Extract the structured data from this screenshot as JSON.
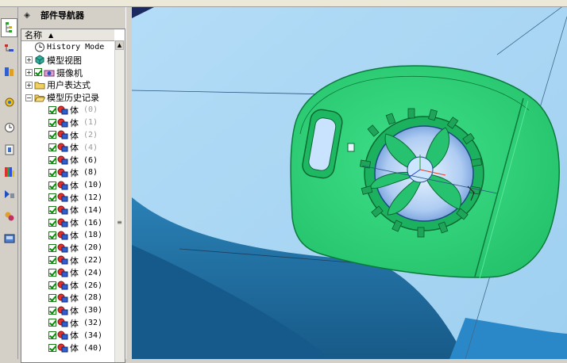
{
  "navigator": {
    "title": "部件导航器",
    "column_header": "名称",
    "history_mode": "History Mode",
    "nodes": [
      {
        "label": "模型视图",
        "icon": "model-views-icon"
      },
      {
        "label": "摄像机",
        "icon": "camera-icon"
      },
      {
        "label": "用户表达式",
        "icon": "folder-icon"
      },
      {
        "label": "模型历史记录",
        "icon": "folder-icon"
      }
    ],
    "features": [
      {
        "name": "体",
        "id": "(0)",
        "dim": true
      },
      {
        "name": "体",
        "id": "(1)",
        "dim": true
      },
      {
        "name": "体",
        "id": "(2)",
        "dim": true
      },
      {
        "name": "体",
        "id": "(4)",
        "dim": true
      },
      {
        "name": "体",
        "id": "(6)",
        "dim": false
      },
      {
        "name": "体",
        "id": "(8)",
        "dim": false
      },
      {
        "name": "体",
        "id": "(10)",
        "dim": false
      },
      {
        "name": "体",
        "id": "(12)",
        "dim": false
      },
      {
        "name": "体",
        "id": "(14)",
        "dim": false
      },
      {
        "name": "体",
        "id": "(16)",
        "dim": false
      },
      {
        "name": "体",
        "id": "(18)",
        "dim": false
      },
      {
        "name": "体",
        "id": "(20)",
        "dim": false
      },
      {
        "name": "体",
        "id": "(22)",
        "dim": false
      },
      {
        "name": "体",
        "id": "(24)",
        "dim": false
      },
      {
        "name": "体",
        "id": "(26)",
        "dim": false
      },
      {
        "name": "体",
        "id": "(28)",
        "dim": false
      },
      {
        "name": "体",
        "id": "(30)",
        "dim": false
      },
      {
        "name": "体",
        "id": "(32)",
        "dim": false
      },
      {
        "name": "体",
        "id": "(34)",
        "dim": false
      },
      {
        "name": "体",
        "id": "(40)",
        "dim": false
      }
    ]
  },
  "resource_bar": {
    "buttons": [
      "assembly-navigator-icon",
      "part-navigator-icon",
      "constraint-navigator-icon",
      "reuse-library-icon",
      "history-icon",
      "system-materials-icon",
      "visualization-icon",
      "roles-icon",
      "web-browser-icon",
      "palette-icon"
    ]
  },
  "colors": {
    "part_green": "#2fd47a",
    "part_green_dark": "#0b7a3a",
    "background_light_blue": "#b9def5",
    "background_dark_blue": "#1f6ea0",
    "check_green": "#0a8a0a"
  }
}
